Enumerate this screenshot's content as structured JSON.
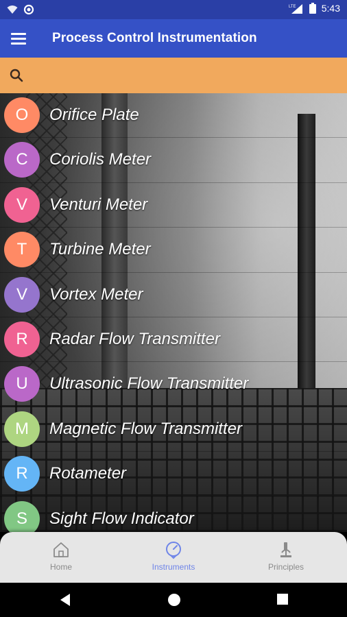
{
  "status_bar": {
    "time": "5:43",
    "network": "LTE"
  },
  "app_bar": {
    "title": "Process Control Instrumentation",
    "menu_icon": "hamburger-menu-icon"
  },
  "search": {
    "value": "",
    "placeholder": ""
  },
  "instruments": [
    {
      "letter": "O",
      "name": "Orifice Plate",
      "color": "#ff8a65"
    },
    {
      "letter": "C",
      "name": "Coriolis Meter",
      "color": "#ba68c8"
    },
    {
      "letter": "V",
      "name": "Venturi Meter",
      "color": "#f06292"
    },
    {
      "letter": "T",
      "name": "Turbine Meter",
      "color": "#ff8a65"
    },
    {
      "letter": "V",
      "name": "Vortex Meter",
      "color": "#9575cd"
    },
    {
      "letter": "R",
      "name": "Radar Flow Transmitter",
      "color": "#f06292"
    },
    {
      "letter": "U",
      "name": "Ultrasonic Flow Transmitter",
      "color": "#ba68c8"
    },
    {
      "letter": "M",
      "name": "Magnetic Flow Transmitter",
      "color": "#aed581"
    },
    {
      "letter": "R",
      "name": "Rotameter",
      "color": "#64b5f6"
    },
    {
      "letter": "S",
      "name": "Sight Flow Indicator",
      "color": "#81c784"
    }
  ],
  "bottom_nav": {
    "items": [
      {
        "label": "Home",
        "icon": "home-icon",
        "active": false
      },
      {
        "label": "Instruments",
        "icon": "gauge-icon",
        "active": true
      },
      {
        "label": "Principles",
        "icon": "microscope-icon",
        "active": false
      }
    ],
    "active_color": "#6f85e8",
    "inactive_color": "#8a8a8a"
  },
  "system_nav": [
    "back-icon",
    "home-circle-icon",
    "recents-square-icon"
  ]
}
